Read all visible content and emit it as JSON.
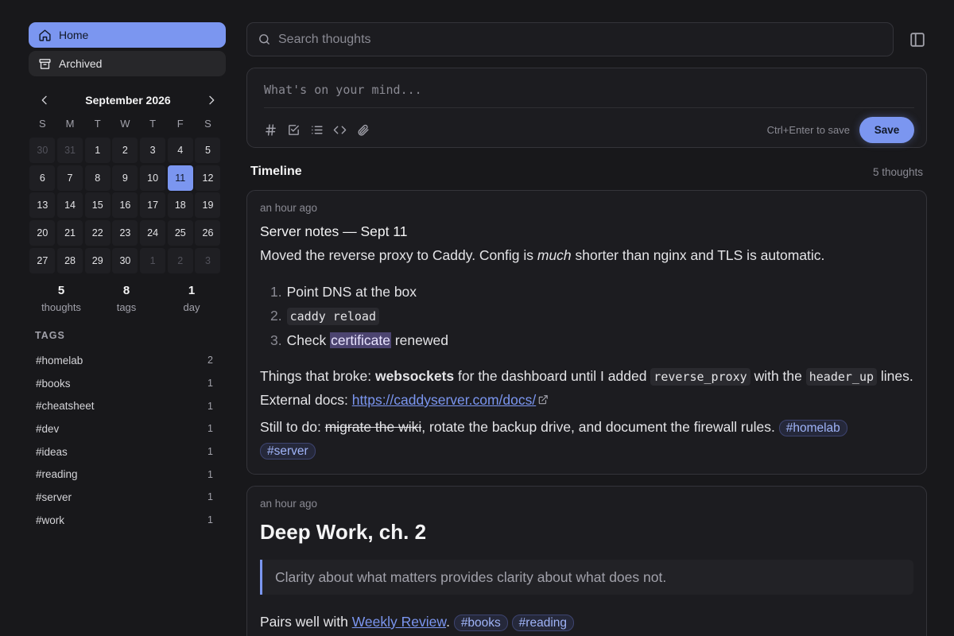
{
  "nav": {
    "home_label": "Home",
    "archived_label": "Archived"
  },
  "calendar": {
    "month_label": "September 2026",
    "weekdays": [
      "S",
      "M",
      "T",
      "W",
      "T",
      "F",
      "S"
    ],
    "days": [
      {
        "d": "30",
        "muted": true
      },
      {
        "d": "31",
        "muted": true
      },
      {
        "d": "1"
      },
      {
        "d": "2"
      },
      {
        "d": "3"
      },
      {
        "d": "4"
      },
      {
        "d": "5"
      },
      {
        "d": "6"
      },
      {
        "d": "7"
      },
      {
        "d": "8"
      },
      {
        "d": "9"
      },
      {
        "d": "10"
      },
      {
        "d": "11",
        "selected": true
      },
      {
        "d": "12"
      },
      {
        "d": "13"
      },
      {
        "d": "14"
      },
      {
        "d": "15"
      },
      {
        "d": "16"
      },
      {
        "d": "17"
      },
      {
        "d": "18"
      },
      {
        "d": "19"
      },
      {
        "d": "20"
      },
      {
        "d": "21"
      },
      {
        "d": "22"
      },
      {
        "d": "23"
      },
      {
        "d": "24"
      },
      {
        "d": "25"
      },
      {
        "d": "26"
      },
      {
        "d": "27"
      },
      {
        "d": "28"
      },
      {
        "d": "29"
      },
      {
        "d": "30"
      },
      {
        "d": "1",
        "muted": true
      },
      {
        "d": "2",
        "muted": true
      },
      {
        "d": "3",
        "muted": true
      }
    ]
  },
  "stats": {
    "thoughts": {
      "num": "5",
      "label": "thoughts"
    },
    "tags": {
      "num": "8",
      "label": "tags"
    },
    "days": {
      "num": "1",
      "label": "day"
    }
  },
  "tags": {
    "heading": "TAGS",
    "items": [
      {
        "name": "#homelab",
        "count": "2"
      },
      {
        "name": "#books",
        "count": "1"
      },
      {
        "name": "#cheatsheet",
        "count": "1"
      },
      {
        "name": "#dev",
        "count": "1"
      },
      {
        "name": "#ideas",
        "count": "1"
      },
      {
        "name": "#reading",
        "count": "1"
      },
      {
        "name": "#server",
        "count": "1"
      },
      {
        "name": "#work",
        "count": "1"
      }
    ]
  },
  "search": {
    "placeholder": "Search thoughts"
  },
  "composer": {
    "placeholder": "What's on your mind...",
    "hint": "Ctrl+Enter to save",
    "save_label": "Save"
  },
  "timeline": {
    "title": "Timeline",
    "count": "5 thoughts"
  },
  "note1": {
    "time": "an hour ago",
    "title": "Server notes — Sept 11",
    "p1_a": "Moved the reverse proxy to Caddy. Config is ",
    "p1_em": "much",
    "p1_b": " shorter than nginx and TLS is automatic.",
    "steps": {
      "n1": "1.",
      "s1": "Point DNS at the box",
      "n2": "2.",
      "s2": "caddy reload",
      "n3": "3.",
      "s3_a": "Check ",
      "s3_hl": "certificate",
      "s3_b": " renewed"
    },
    "p2_a": "Things that broke: ",
    "p2_bold": "websockets",
    "p2_b": " for the dashboard until I added ",
    "p2_code1": "reverse_proxy",
    "p2_c": " with the ",
    "p2_code2": "header_up",
    "p2_d": " lines. External docs: ",
    "p2_link": "https://caddyserver.com/docs/",
    "p3_a": "Still to do: ",
    "p3_strike": "migrate the wiki",
    "p3_b": ", rotate the backup drive, and document the firewall rules. ",
    "tag1": "#homelab",
    "tag2": "#server"
  },
  "note2": {
    "time": "an hour ago",
    "heading": "Deep Work, ch. 2",
    "quote": "Clarity about what matters provides clarity about what does not.",
    "p_a": "Pairs well with ",
    "p_link": "Weekly Review",
    "p_b": ". ",
    "tag1": "#books",
    "tag2": "#reading"
  },
  "colors": {
    "accent": "#7b96f0",
    "background": "#18181b",
    "card": "#1c1c20"
  }
}
